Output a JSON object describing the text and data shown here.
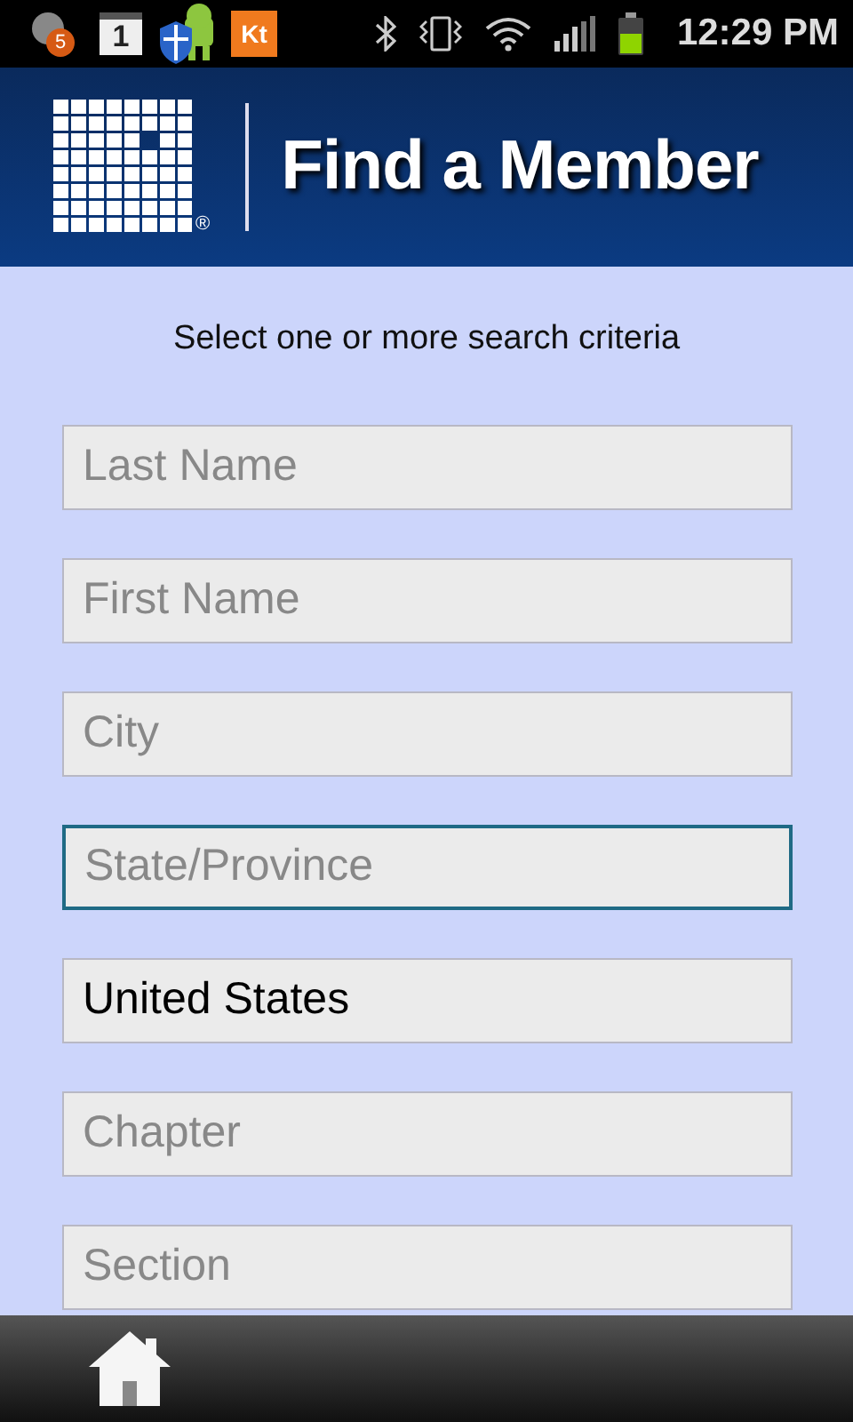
{
  "status_bar": {
    "notifications": [
      {
        "kind": "badge",
        "text": "5"
      },
      {
        "kind": "calendar",
        "text": "1"
      },
      {
        "kind": "shield"
      },
      {
        "kind": "app",
        "text": "Kt"
      }
    ],
    "time": "12:29 PM"
  },
  "header": {
    "logo_mark": "®",
    "title": "Find a Member"
  },
  "instructions": "Select one or more search criteria",
  "fields": [
    {
      "placeholder": "Last Name",
      "focused": false
    },
    {
      "placeholder": "First Name",
      "focused": false
    },
    {
      "placeholder": "City",
      "focused": false
    },
    {
      "placeholder": "State/Province",
      "focused": true
    },
    {
      "value": "United States",
      "focused": false
    },
    {
      "placeholder": "Chapter",
      "focused": false
    },
    {
      "placeholder": "Section",
      "focused": false
    }
  ]
}
